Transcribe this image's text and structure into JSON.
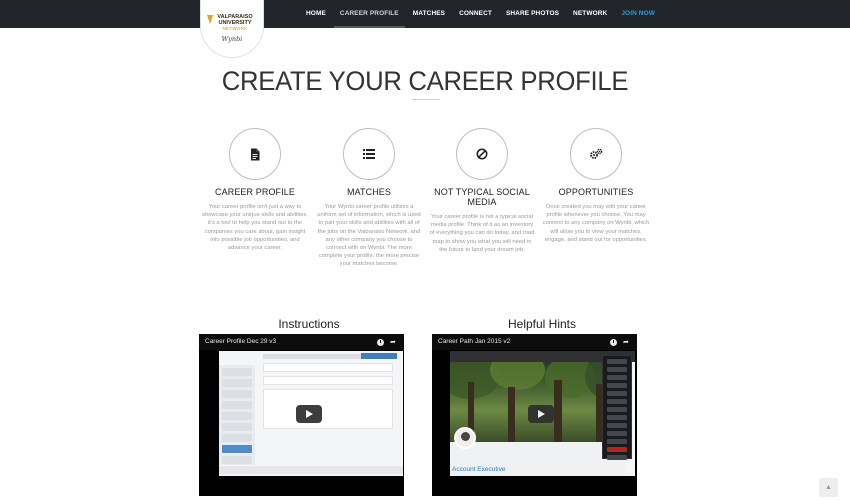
{
  "logo": {
    "line1": "VALPARAISO",
    "line2": "UNIVERSITY",
    "line3": "NETWORK",
    "signature": "Wynbi"
  },
  "nav": {
    "items": [
      {
        "label": "HOME"
      },
      {
        "label": "CAREER PROFILE"
      },
      {
        "label": "MATCHES"
      },
      {
        "label": "CONNECT"
      },
      {
        "label": "SHARE PHOTOS"
      },
      {
        "label": "NETWORK"
      },
      {
        "label": "JOIN NOW"
      }
    ],
    "active_index": 1
  },
  "page_title": "CREATE YOUR CAREER PROFILE",
  "features": [
    {
      "icon": "document-icon",
      "title": "CAREER PROFILE",
      "text": "Your career profile isn't just a way to showcase your unique skills and abilities, it's a tool to help you stand out to the companies you care about, gain insight into possible job opportunities, and advance your career."
    },
    {
      "icon": "list-icon",
      "title": "MATCHES",
      "text": "Your Wynbi career profile utilizes a uniform set of information, which is used to pair your skills and abilities with all of the jobs on the Valparaiso Network, and any other company you choose to connect with on Wynbi. The more complete your profile, the more precise your matches become."
    },
    {
      "icon": "no-entry-icon",
      "title": "NOT TYPICAL SOCIAL MEDIA",
      "text": "Your career profile is not a typical social media profile. Think of it as an inventory of everything you can do today, and road map to show you what you will need in the future to land your dream job."
    },
    {
      "icon": "gears-icon",
      "title": "OPPORTUNITIES",
      "text": "Once created you may edit your career profile whenever you choose. You may connect to any company on Wynbi, which will allow you to view your matches, engage, and stand out for opportunities."
    }
  ],
  "videos": [
    {
      "heading": "Instructions",
      "title": "Career Profile Dec 29 v3"
    },
    {
      "heading": "Helpful Hints",
      "title": "Career Path Jan 2015 v2",
      "account_label": "Account Executive"
    }
  ],
  "colors": {
    "nav_bg": "#222529",
    "join_now": "#2b9ad8",
    "logo_gold": "#e3a21a"
  }
}
